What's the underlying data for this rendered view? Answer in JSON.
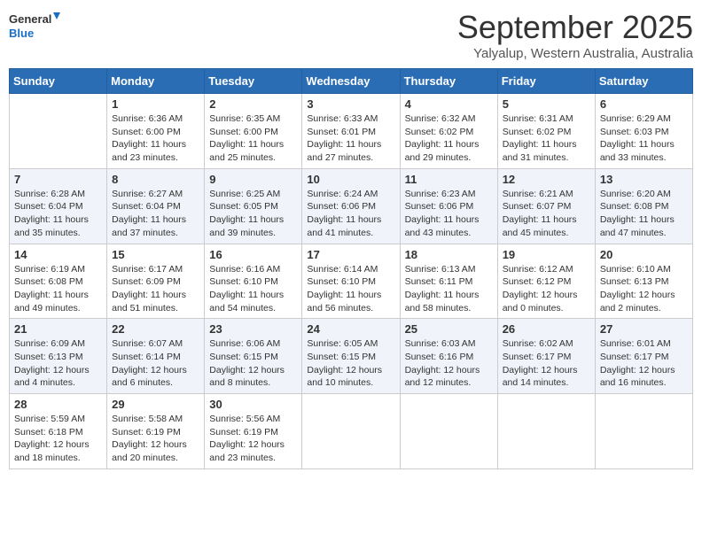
{
  "logo": {
    "line1": "General",
    "line2": "Blue"
  },
  "title": "September 2025",
  "location": "Yalyalup, Western Australia, Australia",
  "headers": [
    "Sunday",
    "Monday",
    "Tuesday",
    "Wednesday",
    "Thursday",
    "Friday",
    "Saturday"
  ],
  "weeks": [
    [
      {
        "day": "",
        "info": ""
      },
      {
        "day": "1",
        "info": "Sunrise: 6:36 AM\nSunset: 6:00 PM\nDaylight: 11 hours\nand 23 minutes."
      },
      {
        "day": "2",
        "info": "Sunrise: 6:35 AM\nSunset: 6:00 PM\nDaylight: 11 hours\nand 25 minutes."
      },
      {
        "day": "3",
        "info": "Sunrise: 6:33 AM\nSunset: 6:01 PM\nDaylight: 11 hours\nand 27 minutes."
      },
      {
        "day": "4",
        "info": "Sunrise: 6:32 AM\nSunset: 6:02 PM\nDaylight: 11 hours\nand 29 minutes."
      },
      {
        "day": "5",
        "info": "Sunrise: 6:31 AM\nSunset: 6:02 PM\nDaylight: 11 hours\nand 31 minutes."
      },
      {
        "day": "6",
        "info": "Sunrise: 6:29 AM\nSunset: 6:03 PM\nDaylight: 11 hours\nand 33 minutes."
      }
    ],
    [
      {
        "day": "7",
        "info": "Sunrise: 6:28 AM\nSunset: 6:04 PM\nDaylight: 11 hours\nand 35 minutes."
      },
      {
        "day": "8",
        "info": "Sunrise: 6:27 AM\nSunset: 6:04 PM\nDaylight: 11 hours\nand 37 minutes."
      },
      {
        "day": "9",
        "info": "Sunrise: 6:25 AM\nSunset: 6:05 PM\nDaylight: 11 hours\nand 39 minutes."
      },
      {
        "day": "10",
        "info": "Sunrise: 6:24 AM\nSunset: 6:06 PM\nDaylight: 11 hours\nand 41 minutes."
      },
      {
        "day": "11",
        "info": "Sunrise: 6:23 AM\nSunset: 6:06 PM\nDaylight: 11 hours\nand 43 minutes."
      },
      {
        "day": "12",
        "info": "Sunrise: 6:21 AM\nSunset: 6:07 PM\nDaylight: 11 hours\nand 45 minutes."
      },
      {
        "day": "13",
        "info": "Sunrise: 6:20 AM\nSunset: 6:08 PM\nDaylight: 11 hours\nand 47 minutes."
      }
    ],
    [
      {
        "day": "14",
        "info": "Sunrise: 6:19 AM\nSunset: 6:08 PM\nDaylight: 11 hours\nand 49 minutes."
      },
      {
        "day": "15",
        "info": "Sunrise: 6:17 AM\nSunset: 6:09 PM\nDaylight: 11 hours\nand 51 minutes."
      },
      {
        "day": "16",
        "info": "Sunrise: 6:16 AM\nSunset: 6:10 PM\nDaylight: 11 hours\nand 54 minutes."
      },
      {
        "day": "17",
        "info": "Sunrise: 6:14 AM\nSunset: 6:10 PM\nDaylight: 11 hours\nand 56 minutes."
      },
      {
        "day": "18",
        "info": "Sunrise: 6:13 AM\nSunset: 6:11 PM\nDaylight: 11 hours\nand 58 minutes."
      },
      {
        "day": "19",
        "info": "Sunrise: 6:12 AM\nSunset: 6:12 PM\nDaylight: 12 hours\nand 0 minutes."
      },
      {
        "day": "20",
        "info": "Sunrise: 6:10 AM\nSunset: 6:13 PM\nDaylight: 12 hours\nand 2 minutes."
      }
    ],
    [
      {
        "day": "21",
        "info": "Sunrise: 6:09 AM\nSunset: 6:13 PM\nDaylight: 12 hours\nand 4 minutes."
      },
      {
        "day": "22",
        "info": "Sunrise: 6:07 AM\nSunset: 6:14 PM\nDaylight: 12 hours\nand 6 minutes."
      },
      {
        "day": "23",
        "info": "Sunrise: 6:06 AM\nSunset: 6:15 PM\nDaylight: 12 hours\nand 8 minutes."
      },
      {
        "day": "24",
        "info": "Sunrise: 6:05 AM\nSunset: 6:15 PM\nDaylight: 12 hours\nand 10 minutes."
      },
      {
        "day": "25",
        "info": "Sunrise: 6:03 AM\nSunset: 6:16 PM\nDaylight: 12 hours\nand 12 minutes."
      },
      {
        "day": "26",
        "info": "Sunrise: 6:02 AM\nSunset: 6:17 PM\nDaylight: 12 hours\nand 14 minutes."
      },
      {
        "day": "27",
        "info": "Sunrise: 6:01 AM\nSunset: 6:17 PM\nDaylight: 12 hours\nand 16 minutes."
      }
    ],
    [
      {
        "day": "28",
        "info": "Sunrise: 5:59 AM\nSunset: 6:18 PM\nDaylight: 12 hours\nand 18 minutes."
      },
      {
        "day": "29",
        "info": "Sunrise: 5:58 AM\nSunset: 6:19 PM\nDaylight: 12 hours\nand 20 minutes."
      },
      {
        "day": "30",
        "info": "Sunrise: 5:56 AM\nSunset: 6:19 PM\nDaylight: 12 hours\nand 23 minutes."
      },
      {
        "day": "",
        "info": ""
      },
      {
        "day": "",
        "info": ""
      },
      {
        "day": "",
        "info": ""
      },
      {
        "day": "",
        "info": ""
      }
    ]
  ]
}
